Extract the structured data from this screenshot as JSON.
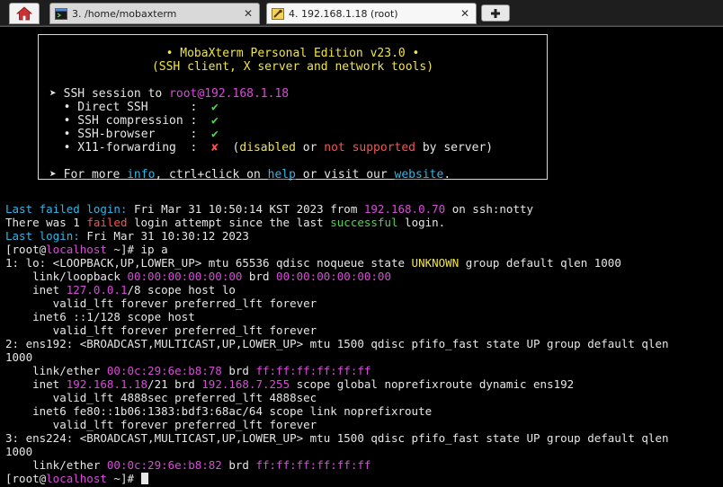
{
  "tabs": {
    "home_icon": "home-icon",
    "tab1_label": "3. /home/mobaxterm",
    "tab2_label": "4. 192.168.1.18 (root)",
    "close": "✕",
    "new_tab": "+"
  },
  "banner": {
    "title": "• MobaXterm Personal Edition v23.0 •",
    "subtitle": "(SSH client, X server and network tools)",
    "ssh_prefix": "➤ SSH session to ",
    "ssh_target": "root@192.168.1.18",
    "opt1": "  • Direct SSH      :  ",
    "opt2": "  • SSH compression :  ",
    "opt3": "  • SSH-browser     :  ",
    "opt4": "  • X11-forwarding  :  ",
    "check": "✔",
    "cross": "✘",
    "x11_paren_open": "  (",
    "x11_disabled": "disabled",
    "x11_or": " or ",
    "x11_notsupported": "not supported",
    "x11_rest": " by server)",
    "more_a": "➤ For more ",
    "more_info": "info",
    "more_b": ", ctrl+click on ",
    "more_help": "help",
    "more_c": " or visit our ",
    "more_website": "website",
    "more_d": "."
  },
  "term": {
    "l1a": "Last failed login:",
    "l1b": " Fri Mar 31 10:50:14 KST 2023 from ",
    "l1c": "192.168.0.70",
    "l1d": " on ssh:notty",
    "l2a": "There was 1 ",
    "l2b": "failed",
    "l2c": " login attempt since the last ",
    "l2d": "successful",
    "l2e": " login.",
    "l3a": "Last login:",
    "l3b": " Fri Mar 31 10:30:12 2023",
    "p_open": "[root@",
    "p_host": "localhost",
    "p_cmd": " ~]# ip a",
    "p_close": " ~]# ",
    "l5a": "1: lo: <LOOPBACK,UP,LOWER_UP> mtu 65536 qdisc noqueue state ",
    "l5b": "UNKNOWN",
    "l5c": " group default qlen 1000",
    "l6a": "    link/loopback ",
    "l6b": "00:00:00:00:00:00",
    "l6c": " brd ",
    "l6d": "00:00:00:00:00:00",
    "l7a": "    inet ",
    "l7b": "127.0.0.1",
    "l7c": "/8 scope host lo",
    "l8": "       valid_lft forever preferred_lft forever",
    "l9": "    inet6 ::1/128 scope host",
    "l10": "       valid_lft forever preferred_lft forever",
    "l11": "2: ens192: <BROADCAST,MULTICAST,UP,LOWER_UP> mtu 1500 qdisc pfifo_fast state UP group default qlen",
    "l12": "1000",
    "l13a": "    link/ether ",
    "l13b": "00:0c:29:6e:b8:78",
    "l13c": " brd ",
    "l13d": "ff:ff:ff:ff:ff:ff",
    "l14a": "    inet ",
    "l14b": "192.168.1.18",
    "l14c": "/21 brd ",
    "l14d": "192.168.7.255",
    "l14e": " scope global noprefixroute dynamic ens192",
    "l15": "       valid_lft 4888sec preferred_lft 4888sec",
    "l16": "    inet6 fe80::1b06:1383:bdf3:68ac/64 scope link noprefixroute",
    "l17": "       valid_lft forever preferred_lft forever",
    "l18": "3: ens224: <BROADCAST,MULTICAST,UP,LOWER_UP> mtu 1500 qdisc pfifo_fast state UP group default qlen",
    "l19": "1000",
    "l20a": "    link/ether ",
    "l20b": "00:0c:29:6e:b8:82",
    "l20c": " brd ",
    "l20d": "ff:ff:ff:ff:ff:ff"
  }
}
